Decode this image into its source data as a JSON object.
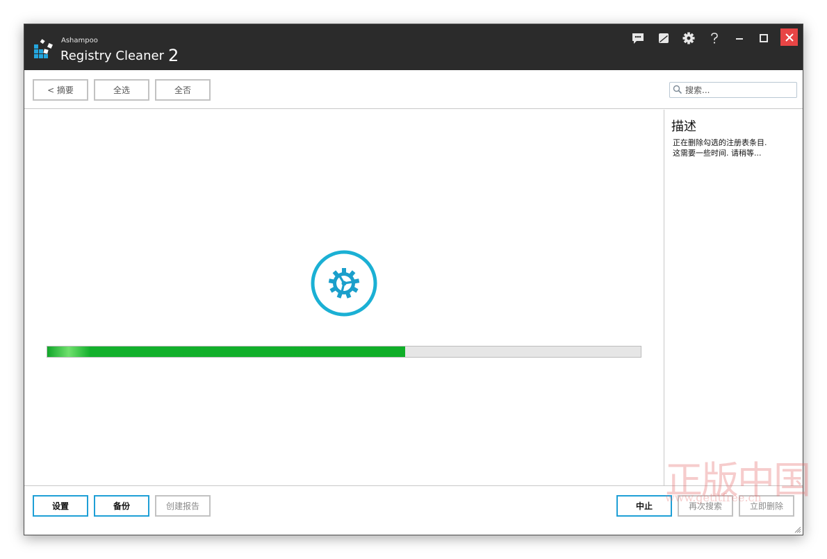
{
  "titlebar": {
    "brand_small": "Ashampoo",
    "brand_name": "Registry Cleaner",
    "brand_version": "2",
    "icons": [
      "feedback-icon",
      "skin-icon",
      "gear-icon",
      "help-icon",
      "minimize-icon",
      "maximize-icon",
      "close-icon"
    ]
  },
  "toolbar": {
    "back_label": "< 摘要",
    "select_all_label": "全选",
    "select_none_label": "全否",
    "search_placeholder": "搜索..."
  },
  "side": {
    "title": "描述",
    "line1": "正在删除勾选的注册表条目.",
    "line2": "这需要一些时间. 请稍等..."
  },
  "progress": {
    "value": 0.603
  },
  "footer": {
    "settings_label": "设置",
    "backup_label": "备份",
    "report_label": "创建报告",
    "stop_label": "中止",
    "rescan_label": "再次搜索",
    "delete_label": "立即删除"
  },
  "watermark": {
    "big": "正版中国",
    "small": "www.getitfree.cn"
  },
  "colors": {
    "accent": "#1e9fd6",
    "progress_fill": "#13b02c",
    "close": "#e84545",
    "titlebar": "#2b2b2b"
  }
}
